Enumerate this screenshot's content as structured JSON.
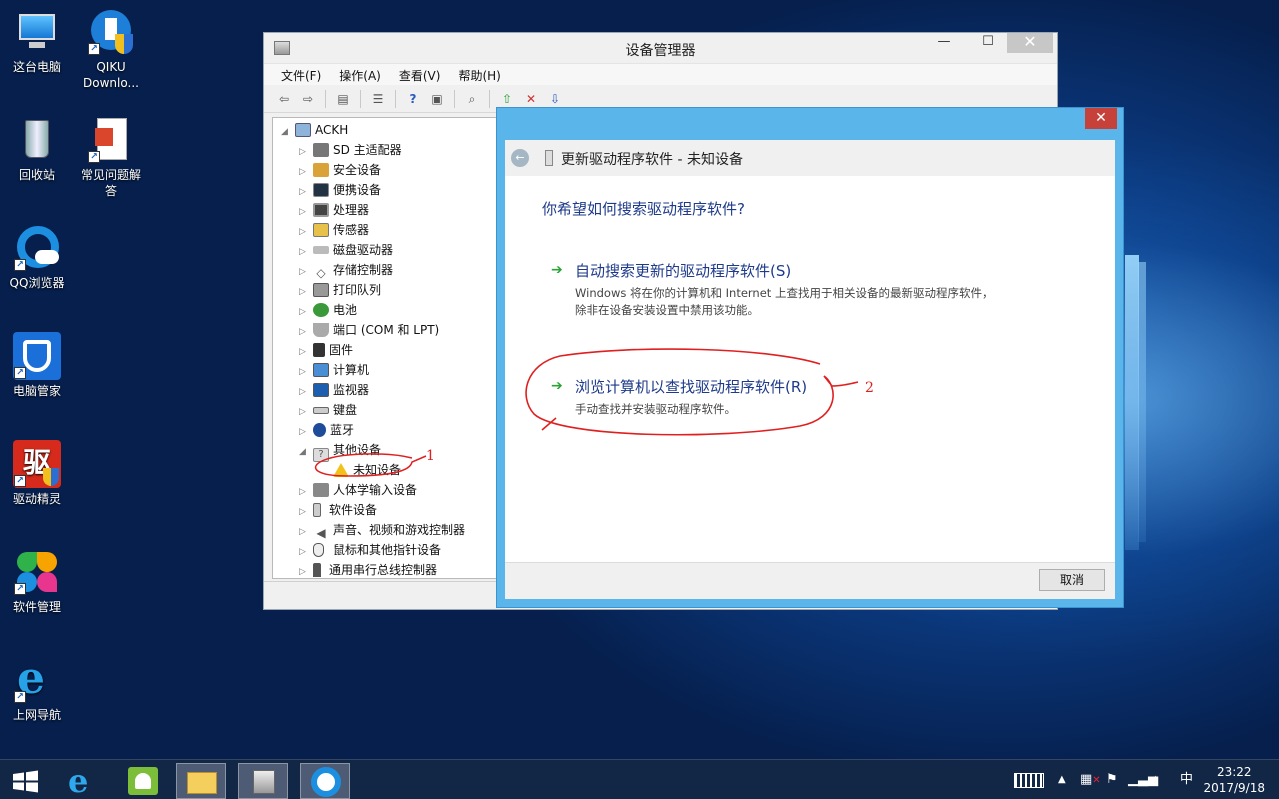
{
  "colors": {
    "accent": "#5ab5ea",
    "annotation": "#e02020",
    "link_green": "#2aa436",
    "link_blue": "#1e3a8a"
  },
  "desktop": {
    "icons": [
      {
        "label": "这台电脑",
        "icon": "computer-icon"
      },
      {
        "label": "QIKU Downlo...",
        "icon": "download-icon"
      },
      {
        "label": "回收站",
        "icon": "recycle-bin-icon"
      },
      {
        "label": "常见问题解答",
        "icon": "document-icon"
      },
      {
        "label": "QQ浏览器",
        "icon": "qq-browser-icon"
      },
      {
        "label": "电脑管家",
        "icon": "pc-manager-icon"
      },
      {
        "label": "驱动精灵",
        "icon": "driver-genius-icon"
      },
      {
        "label": "软件管理",
        "icon": "software-manager-icon"
      },
      {
        "label": "上网导航",
        "icon": "ie-icon"
      }
    ]
  },
  "device_manager": {
    "title": "设备管理器",
    "menus": [
      "文件(F)",
      "操作(A)",
      "查看(V)",
      "帮助(H)"
    ],
    "root": "ACKH",
    "items": [
      "SD 主适配器",
      "安全设备",
      "便携设备",
      "处理器",
      "传感器",
      "磁盘驱动器",
      "存储控制器",
      "打印队列",
      "电池",
      "端口 (COM 和 LPT)",
      "固件",
      "计算机",
      "监视器",
      "键盘",
      "蓝牙",
      "其他设备",
      "未知设备",
      "人体学输入设备",
      "软件设备",
      "声音、视频和游戏控制器",
      "鼠标和其他指针设备",
      "通用串行总线控制器"
    ]
  },
  "dialog": {
    "title": "更新驱动程序软件 - 未知设备",
    "question": "你希望如何搜索驱动程序软件?",
    "option1": {
      "title": "自动搜索更新的驱动程序软件(S)",
      "desc": "Windows 将在你的计算机和 Internet 上查找用于相关设备的最新驱动程序软件，除非在设备安装设置中禁用该功能。"
    },
    "option2": {
      "title": "浏览计算机以查找驱动程序软件(R)",
      "desc": "手动查找并安装驱动程序软件。"
    },
    "cancel": "取消"
  },
  "annotations": {
    "one": "1",
    "two": "2"
  },
  "taskbar": {
    "ime": "中",
    "time": "23:22",
    "date": "2017/9/18"
  }
}
